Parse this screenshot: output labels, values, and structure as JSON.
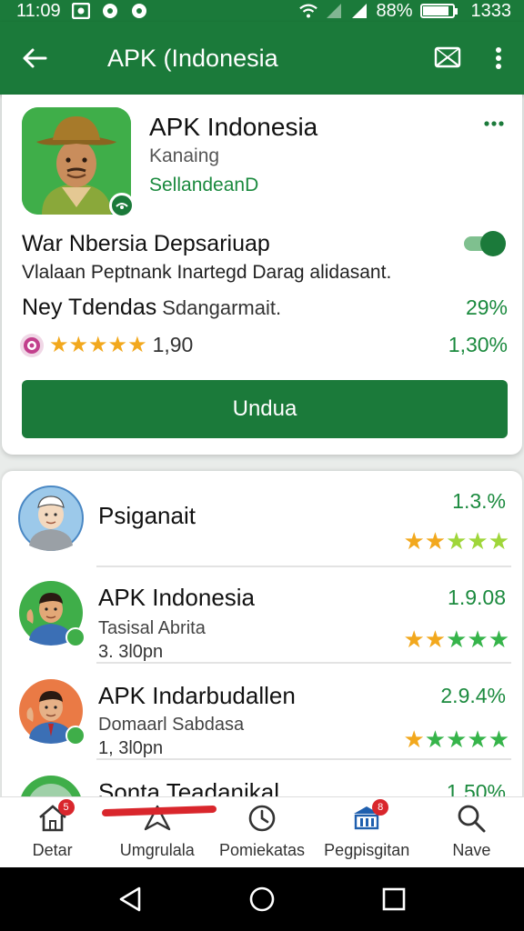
{
  "status_bar": {
    "time": "11:09",
    "battery_text": "88%",
    "extra_number": "1333",
    "battery_level": 0.88,
    "icons": [
      "image-icon",
      "record-icon",
      "record-icon",
      "wifi-icon",
      "signal-icon",
      "signal-icon",
      "battery-icon"
    ]
  },
  "app_bar": {
    "title": "APK (Indonesia",
    "back_icon": "arrow-left-icon",
    "action_icons": [
      "cast-icon",
      "more-vertical-icon"
    ]
  },
  "app": {
    "name": "APK Indonesia",
    "subtitle": "Kanaing",
    "developer": "SellandeanD",
    "feature_title": "War Nbersia Depsariuap",
    "feature_desc": "Vlalaan Peptnank Inartegd Darag alidasant.",
    "toggle_on": true,
    "stat_bold": "Ney Tdendas",
    "stat_light": "Sdangarmait.",
    "stat_pct": "29%",
    "rating_value": "1,90",
    "rating_right": "1,30%",
    "rating_stars": 5,
    "install_label": "Undua"
  },
  "list": [
    {
      "title": "Psiganait",
      "subtitle": "",
      "meta": "",
      "right_value": "1.3.%",
      "star_colors": [
        "orange",
        "orange",
        "lime",
        "lime",
        "lime"
      ]
    },
    {
      "title": "APK Indonesia",
      "subtitle": "Tasisal Abrita",
      "meta": "3. 3l0pn",
      "right_value": "1.9.08",
      "star_colors": [
        "orange",
        "orange",
        "green",
        "green",
        "green"
      ]
    },
    {
      "title": "APK Indarbudallen",
      "subtitle": "Domaarl Sabdasa",
      "meta": "1, 3l0pn",
      "right_value": "2.9.4%",
      "star_colors": [
        "orange",
        "green",
        "green",
        "green",
        "green"
      ]
    },
    {
      "title": "Sonta Teadanikal",
      "subtitle": "",
      "meta": "",
      "right_value": "1.50%",
      "star_colors": []
    }
  ],
  "bottom_nav": [
    {
      "label": "Detar",
      "icon": "home-icon",
      "badge": "5"
    },
    {
      "label": "Umgrulala",
      "icon": "send-icon",
      "badge": ""
    },
    {
      "label": "Pomiekatas",
      "icon": "clock-icon",
      "badge": ""
    },
    {
      "label": "Pegpisgitan",
      "icon": "bank-icon",
      "badge": "8"
    },
    {
      "label": "Nave",
      "icon": "search-icon",
      "badge": ""
    }
  ],
  "system_nav": [
    "back-triangle-icon",
    "home-circle-icon",
    "recents-square-icon"
  ],
  "colors": {
    "primary": "#1b7a3a",
    "accent_text": "#1b8a3e",
    "star_orange": "#f2a81d",
    "star_green": "#36b44a",
    "badge_red": "#d9262c"
  }
}
